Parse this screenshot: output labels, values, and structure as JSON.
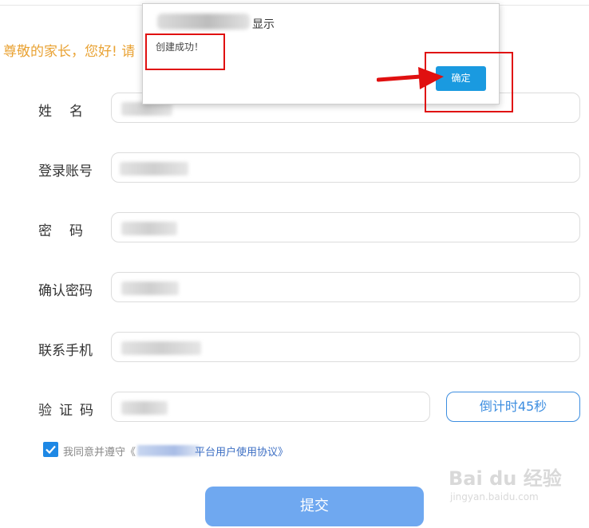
{
  "greeting": "尊敬的家长，您好! 请",
  "form": {
    "name_label": "姓名",
    "account_label": "登录账号",
    "password_label": "密码",
    "confirm_password_label": "确认密码",
    "phone_label": "联系手机",
    "code_label": "验证码",
    "countdown_label": "倒计时45秒"
  },
  "agreement": {
    "prefix": "我同意并遵守《",
    "link_text": "平台用户使用协议》",
    "checked": true
  },
  "submit_label": "提交",
  "dialog": {
    "title": "显示",
    "message": "创建成功！",
    "confirm_label": "确定"
  },
  "watermark": {
    "main": "Bai du 经验",
    "sub": "jingyan.baidu.com"
  },
  "colors": {
    "greeting": "#e9a233",
    "primary": "#1a9ae0",
    "submit": "#6fa8f0",
    "annotation": "#e01010"
  }
}
